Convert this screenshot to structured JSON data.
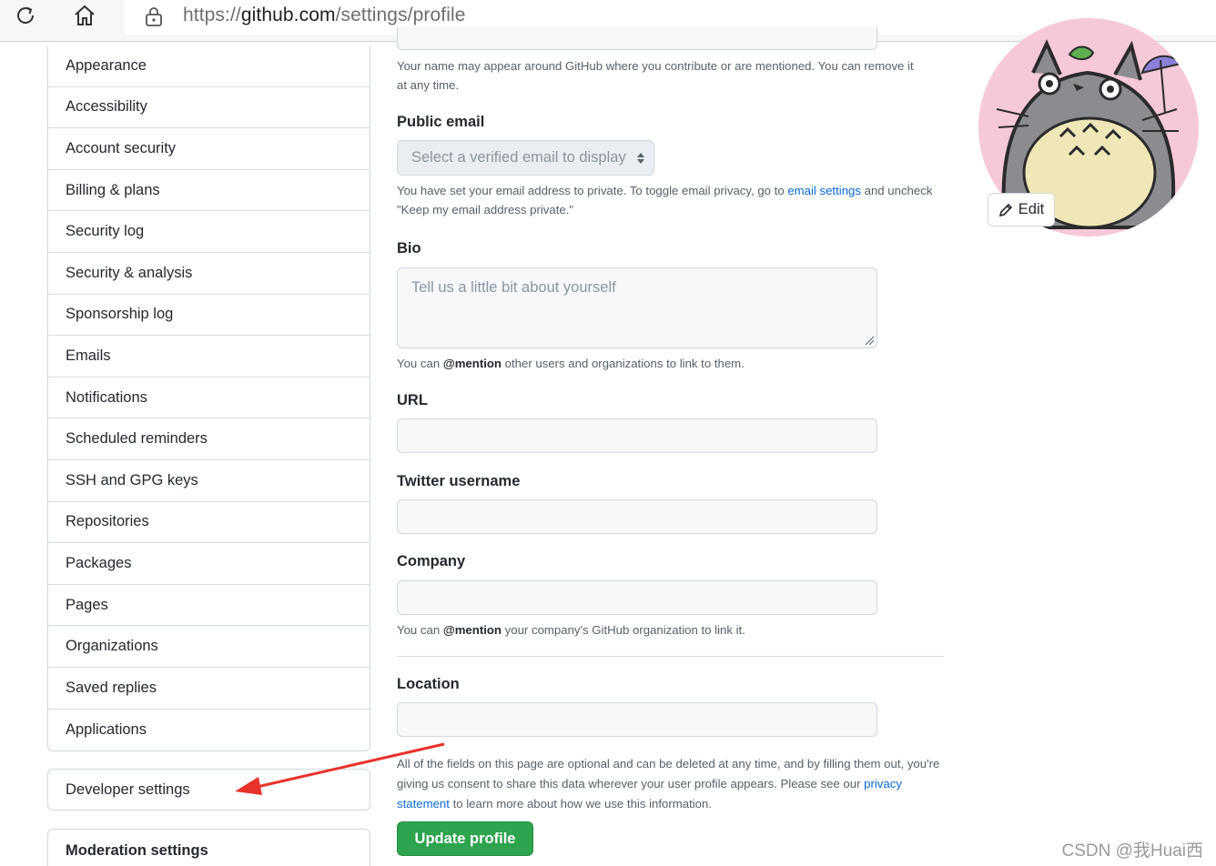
{
  "browser": {
    "url_scheme": "https://",
    "url_host": "github.com",
    "url_path": "/settings/profile"
  },
  "sidebar": {
    "items": [
      "Appearance",
      "Accessibility",
      "Account security",
      "Billing & plans",
      "Security log",
      "Security & analysis",
      "Sponsorship log",
      "Emails",
      "Notifications",
      "Scheduled reminders",
      "SSH and GPG keys",
      "Repositories",
      "Packages",
      "Pages",
      "Organizations",
      "Saved replies",
      "Applications"
    ],
    "developer_settings": "Developer settings",
    "moderation_settings": "Moderation settings"
  },
  "form": {
    "name_note": "Your name may appear around GitHub where you contribute or are mentioned. You can remove it at any time.",
    "public_email_label": "Public email",
    "public_email_select": "Select a verified email to display",
    "email_note_pre": "You have set your email address to private. To toggle email privacy, go to ",
    "email_note_link": "email settings",
    "email_note_post": " and uncheck \"Keep my email address private.\"",
    "bio_label": "Bio",
    "bio_placeholder": "Tell us a little bit about yourself",
    "bio_note_pre": "You can ",
    "bio_note_mention": "@mention",
    "bio_note_post": " other users and organizations to link to them.",
    "url_label": "URL",
    "twitter_label": "Twitter username",
    "company_label": "Company",
    "company_note_pre": "You can ",
    "company_note_mention": "@mention",
    "company_note_post": " your company's GitHub organization to link it.",
    "location_label": "Location",
    "footer_note_pre": "All of the fields on this page are optional and can be deleted at any time, and by filling them out, you're giving us consent to share this data wherever your user profile appears. Please see our ",
    "footer_note_link": "privacy statement",
    "footer_note_post": " to learn more about how we use this information.",
    "update_button": "Update profile"
  },
  "avatar": {
    "edit_label": "Edit"
  },
  "watermark": "CSDN @我Huai西",
  "colors": {
    "primary_button": "#2da44e",
    "link": "#0969da",
    "annotation_arrow": "#e8322b",
    "avatar_background": "#f6c9d8"
  }
}
